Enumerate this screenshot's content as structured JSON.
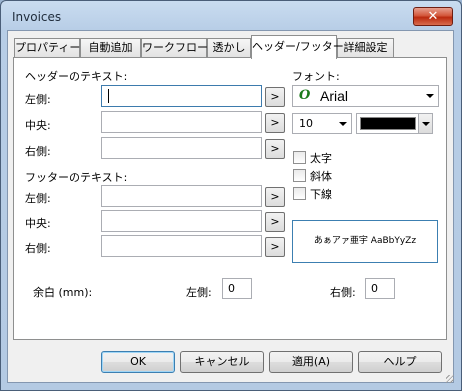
{
  "window": {
    "title": "Invoices",
    "close_glyph": "✕"
  },
  "tabs": [
    {
      "label": "プロパティー"
    },
    {
      "label": "自動追加"
    },
    {
      "label": "ワークフロー"
    },
    {
      "label": "透かし"
    },
    {
      "label": "ヘッダー/フッター",
      "active": true
    },
    {
      "label": "詳細設定"
    }
  ],
  "header": {
    "section_label": "ヘッダーのテキスト:",
    "left_label": "左側:",
    "center_label": "中央:",
    "right_label": "右側:",
    "left_value": "",
    "center_value": "",
    "right_value": ""
  },
  "footer": {
    "section_label": "フッターのテキスト:",
    "left_label": "左側:",
    "center_label": "中央:",
    "right_label": "右側:",
    "left_value": "",
    "center_value": "",
    "right_value": ""
  },
  "insert_button_label": ">",
  "font": {
    "section_label": "フォント:",
    "font_icon_glyph": "O",
    "family": "Arial",
    "size": "10",
    "color": "#000000",
    "bold_label": "太字",
    "italic_label": "斜体",
    "underline_label": "下線",
    "preview_text": "あぁアァ亜宇 AaBbYyZz"
  },
  "margin": {
    "label": "余白 (mm):",
    "left_label": "左側:",
    "left_value": "0",
    "right_label": "右側:",
    "right_value": "0"
  },
  "buttons": {
    "ok": "OK",
    "cancel": "キャンセル",
    "apply": "適用(A)",
    "help": "ヘルプ"
  }
}
